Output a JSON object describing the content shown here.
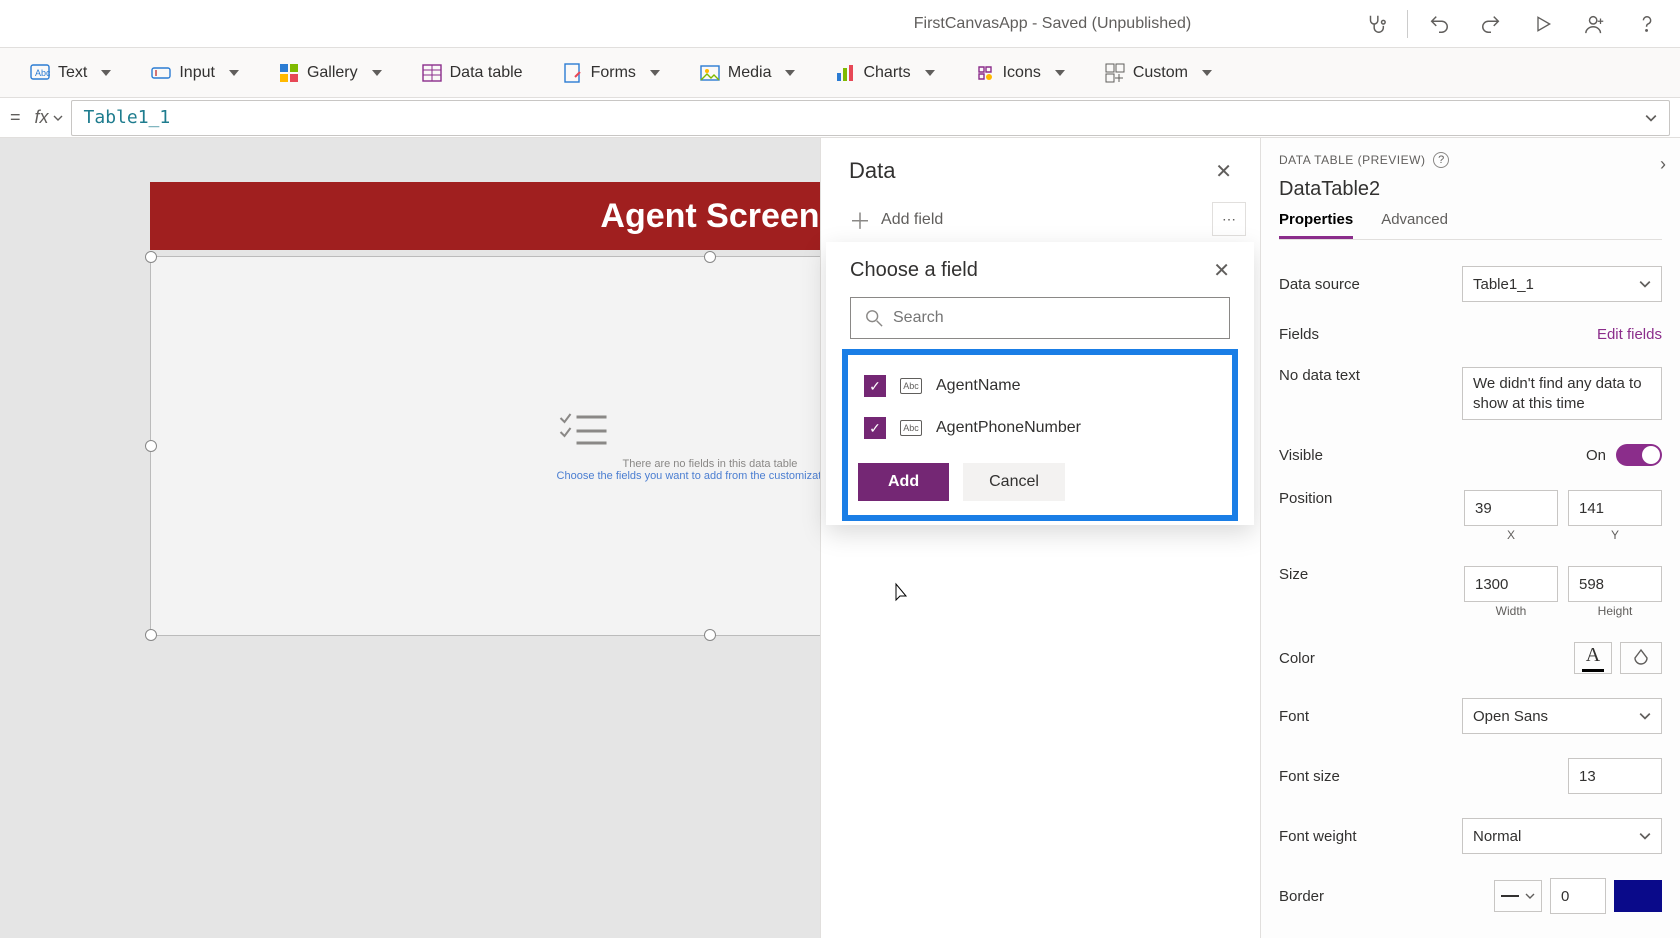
{
  "titleBar": {
    "title": "FirstCanvasApp - Saved (Unpublished)"
  },
  "ribbon": {
    "text": "Text",
    "input": "Input",
    "gallery": "Gallery",
    "dataTable": "Data table",
    "forms": "Forms",
    "media": "Media",
    "charts": "Charts",
    "icons": "Icons",
    "custom": "Custom"
  },
  "formula": {
    "value": "Table1_1"
  },
  "canvas": {
    "banner": "Agent Screen",
    "emptyLine1": "There are no fields in this data table",
    "emptyLine2": "Choose the fields you want to add from the customization pane"
  },
  "dataPane": {
    "title": "Data",
    "addField": "Add field"
  },
  "fieldPopup": {
    "title": "Choose a field",
    "searchPlaceholder": "Search",
    "fields": {
      "f0": "AgentName",
      "f1": "AgentPhoneNumber"
    },
    "addBtn": "Add",
    "cancelBtn": "Cancel"
  },
  "propPane": {
    "sectionLabel": "DATA TABLE (PREVIEW)",
    "elementName": "DataTable2",
    "tabs": {
      "properties": "Properties",
      "advanced": "Advanced"
    },
    "dataSourceLbl": "Data source",
    "dataSourceVal": "Table1_1",
    "fieldsLbl": "Fields",
    "editFields": "Edit fields",
    "noDataLbl": "No data text",
    "noDataVal": "We didn't find any data to show at this time",
    "visibleLbl": "Visible",
    "visibleVal": "On",
    "positionLbl": "Position",
    "posX": "39",
    "posY": "141",
    "posXLbl": "X",
    "posYLbl": "Y",
    "sizeLbl": "Size",
    "width": "1300",
    "height": "598",
    "widthLbl": "Width",
    "heightLbl": "Height",
    "colorLbl": "Color",
    "fontLbl": "Font",
    "fontVal": "Open Sans",
    "fontSizeLbl": "Font size",
    "fontSizeVal": "13",
    "fontWeightLbl": "Font weight",
    "fontWeightVal": "Normal",
    "borderLbl": "Border",
    "borderVal": "0"
  }
}
